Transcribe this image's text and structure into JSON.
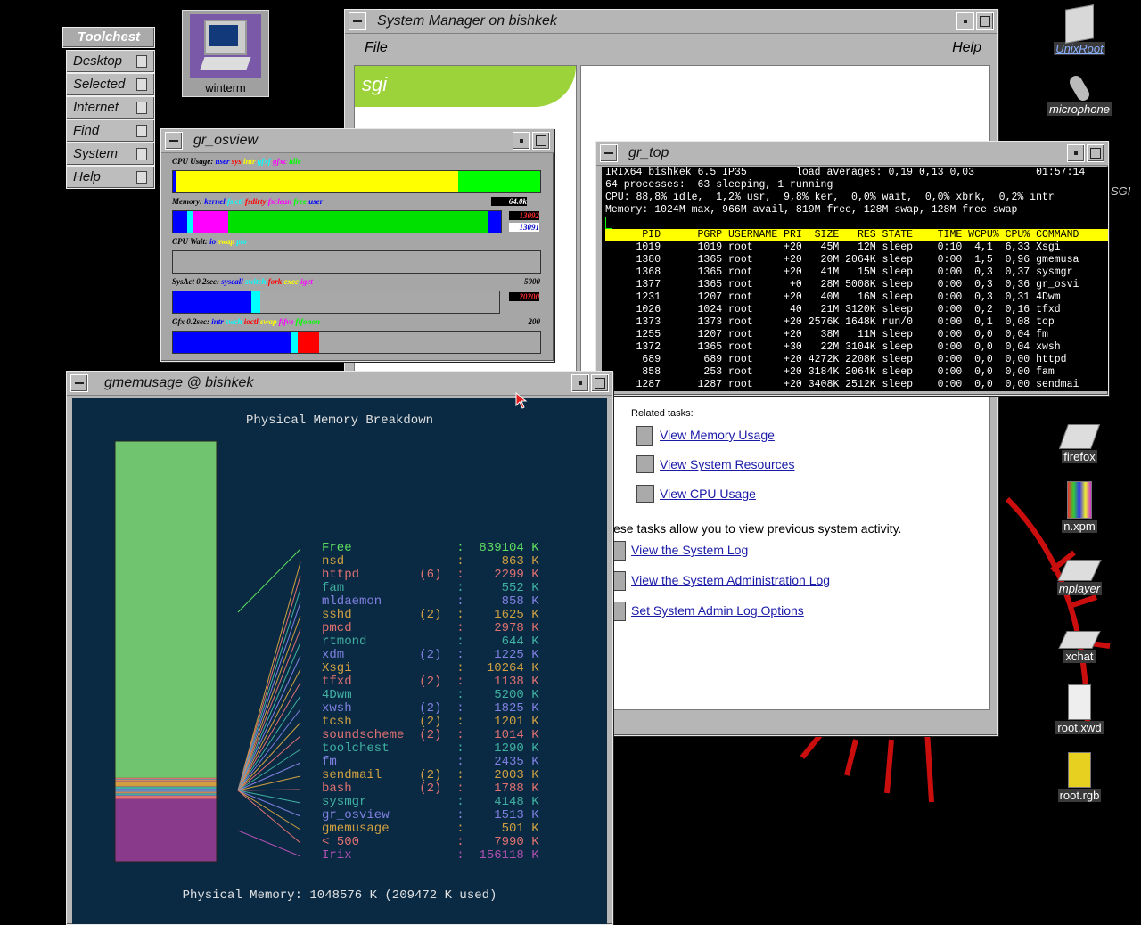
{
  "toolchest": {
    "title": "Toolchest",
    "items": [
      "Desktop",
      "Selected",
      "Internet",
      "Find",
      "System",
      "Help"
    ]
  },
  "desktop_icons": {
    "winterm": "winterm",
    "unixroot": "UnixRoot",
    "microphone": "microphone",
    "firefox": "firefox",
    "nxpm": "n.xpm",
    "mplayer": "mplayer",
    "xchat": "xchat",
    "rootxwd": "root.xwd",
    "rootrgb": "root.rgb",
    "sgi_partial": "SGI"
  },
  "sysmgr": {
    "title": "System Manager on bishkek",
    "menu_file": "File",
    "menu_help": "Help",
    "logo_text": "sgi",
    "related_tasks": "Related tasks:",
    "links": [
      "View Memory Usage",
      "View System Resources",
      "View CPU Usage"
    ],
    "history_text": "ese tasks allow you to view previous system activity.",
    "log_links": [
      "View the System Log",
      "View the System Administration Log",
      "Set System Admin Log Options"
    ]
  },
  "osview": {
    "title": "gr_osview",
    "cpu_label": "CPU Usage:",
    "cpu_legend": [
      [
        "user",
        "#0000ff"
      ],
      [
        "sys",
        "#ff0000"
      ],
      [
        "intr",
        "#ffff00"
      ],
      [
        "gfxf",
        "#00ffff"
      ],
      [
        "gfxc",
        "#ff00ff"
      ],
      [
        "idle",
        "#00ff00"
      ]
    ],
    "cpu_level": 1.0,
    "mem_label": "Memory:",
    "mem_legend": [
      [
        "kernel",
        "#0000ff"
      ],
      [
        "fs ctl",
        "#00ffff"
      ],
      [
        "fsdirty",
        "#ff0000"
      ],
      [
        "fsclean",
        "#ff00ff"
      ],
      [
        "free",
        "#00ff00"
      ],
      [
        "user",
        "#0000ff"
      ]
    ],
    "mem_nums": [
      "64.0k",
      "13092",
      "13091"
    ],
    "wait_label": "CPU Wait:",
    "wait_legend": [
      [
        "io",
        "#0000ff"
      ],
      [
        "swap",
        "#ffff00"
      ],
      [
        "pio",
        "#00ffff"
      ]
    ],
    "sysact_label": "SysAct 0.2sec:",
    "sysact_legend": [
      [
        "syscall",
        "#0000ff"
      ],
      [
        "switch",
        "#00ffff"
      ],
      [
        "fork",
        "#ff0000"
      ],
      [
        "exec",
        "#ffff00"
      ],
      [
        "iget",
        "#ff00ff"
      ]
    ],
    "sysact_nums": [
      "5000",
      "20200"
    ],
    "gfx_label": "Gfx 0.2sec:",
    "gfx_legend": [
      [
        "intr",
        "#0000ff"
      ],
      [
        "swch",
        "#00ffff"
      ],
      [
        "ioctl",
        "#ff0000"
      ],
      [
        "swap",
        "#ffff00"
      ],
      [
        "fifve",
        "#ff00ff"
      ],
      [
        "fifonon",
        "#00ff00"
      ]
    ],
    "gfx_num": "200"
  },
  "grtop": {
    "title": "gr_top",
    "line1": "IRIX64 bishkek 6.5 IP35        load averages: 0,19 0,13 0,03          01:57:14",
    "line2": "64 processes:  63 sleeping, 1 running",
    "line3": "CPU: 88,8% idle,  1,2% usr,  9,8% ker,  0,0% wait,  0,0% xbrk,  0,2% intr",
    "line4": "Memory: 1024M max, 966M avail, 819M free, 128M swap, 128M free swap",
    "header": "      PID      PGRP USERNAME PRI  SIZE   RES STATE    TIME WCPU% CPU% COMMAND",
    "rows": [
      "     1019      1019 root     +20   45M   12M sleep    0:10  4,1  6,33 Xsgi",
      "     1380      1365 root     +20   20M 2064K sleep    0:00  1,5  0,96 gmemusa",
      "     1368      1365 root     +20   41M   15M sleep    0:00  0,3  0,37 sysmgr",
      "     1377      1365 root      +0   28M 5008K sleep    0:00  0,3  0,36 gr_osvi",
      "     1231      1207 root     +20   40M   16M sleep    0:00  0,3  0,31 4Dwm",
      "     1026      1024 root      40   21M 3120K sleep    0:00  0,2  0,16 tfxd",
      "     1373      1373 root     +20 2576K 1648K run/0    0:00  0,1  0,08 top",
      "     1255      1207 root     +20   38M   11M sleep    0:00  0,0  0,04 fm",
      "     1372      1365 root     +30   22M 3104K sleep    0:00  0,0  0,04 xwsh",
      "      689       689 root     +20 4272K 2208K sleep    0:00  0,0  0,00 httpd",
      "      858       253 root     +20 3184K 2064K sleep    0:00  0,0  0,00 fam",
      "     1287      1287 root     +20 3408K 2512K sleep    0:00  0,0  0,00 sendmai"
    ]
  },
  "gmem": {
    "title": "gmemusage @ bishkek",
    "heading": "Physical Memory Breakdown",
    "footer": "Physical Memory: 1048576 K (209472 K used)",
    "rows": [
      {
        "name": "Free",
        "count": "",
        "value": "839104",
        "unit": "K",
        "color": "#60e060"
      },
      {
        "name": "nsd",
        "count": "",
        "value": "863",
        "unit": "K",
        "color": "#d0a040"
      },
      {
        "name": "httpd",
        "count": "(6)",
        "value": "2299",
        "unit": "K",
        "color": "#e07070"
      },
      {
        "name": "fam",
        "count": "",
        "value": "552",
        "unit": "K",
        "color": "#40b0a0"
      },
      {
        "name": "mldaemon",
        "count": "",
        "value": "858",
        "unit": "K",
        "color": "#8080e0"
      },
      {
        "name": "sshd",
        "count": "(2)",
        "value": "1625",
        "unit": "K",
        "color": "#d0a040"
      },
      {
        "name": "pmcd",
        "count": "",
        "value": "2978",
        "unit": "K",
        "color": "#e07070"
      },
      {
        "name": "rtmond",
        "count": "",
        "value": "644",
        "unit": "K",
        "color": "#40b0a0"
      },
      {
        "name": "xdm",
        "count": "(2)",
        "value": "1225",
        "unit": "K",
        "color": "#8080e0"
      },
      {
        "name": "Xsgi",
        "count": "",
        "value": "10264",
        "unit": "K",
        "color": "#d0a040"
      },
      {
        "name": "tfxd",
        "count": "(2)",
        "value": "1138",
        "unit": "K",
        "color": "#e07070"
      },
      {
        "name": "4Dwm",
        "count": "",
        "value": "5200",
        "unit": "K",
        "color": "#40b0a0"
      },
      {
        "name": "xwsh",
        "count": "(2)",
        "value": "1825",
        "unit": "K",
        "color": "#8080e0"
      },
      {
        "name": "tcsh",
        "count": "(2)",
        "value": "1201",
        "unit": "K",
        "color": "#d0a040"
      },
      {
        "name": "soundscheme",
        "count": "(2)",
        "value": "1014",
        "unit": "K",
        "color": "#e07070"
      },
      {
        "name": "toolchest",
        "count": "",
        "value": "1290",
        "unit": "K",
        "color": "#40b0a0"
      },
      {
        "name": "fm",
        "count": "",
        "value": "2435",
        "unit": "K",
        "color": "#8080e0"
      },
      {
        "name": "sendmail",
        "count": "(2)",
        "value": "2003",
        "unit": "K",
        "color": "#d0a040"
      },
      {
        "name": "bash",
        "count": "(2)",
        "value": "1788",
        "unit": "K",
        "color": "#e07070"
      },
      {
        "name": "sysmgr",
        "count": "",
        "value": "4148",
        "unit": "K",
        "color": "#40b0a0"
      },
      {
        "name": "gr_osview",
        "count": "",
        "value": "1513",
        "unit": "K",
        "color": "#8080e0"
      },
      {
        "name": "gmemusage",
        "count": "",
        "value": "501",
        "unit": "K",
        "color": "#d0a040"
      },
      {
        "name": "< 500",
        "count": "",
        "value": "7990",
        "unit": "K",
        "color": "#e07070"
      },
      {
        "name": "Irix",
        "count": "",
        "value": "156118",
        "unit": "K",
        "color": "#b050b0"
      }
    ]
  }
}
